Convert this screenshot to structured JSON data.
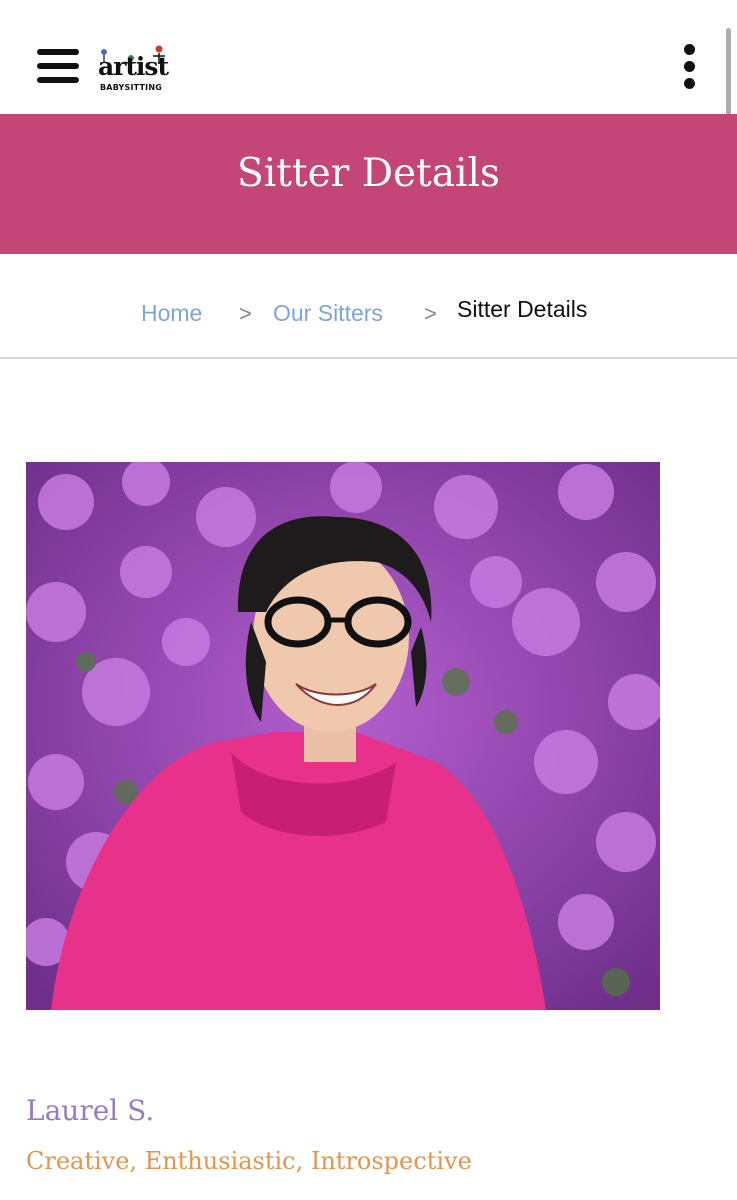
{
  "header": {
    "logo_word": "artist",
    "logo_sub": "BABYSITTING",
    "menu_icon": "hamburger-icon",
    "more_icon": "kebab-menu-icon"
  },
  "banner": {
    "title": "Sitter Details",
    "color": "#c44676"
  },
  "breadcrumb": {
    "items": [
      "Home",
      "Our Sitters",
      "Sitter Details"
    ],
    "separator": ">"
  },
  "profile": {
    "photo_alt": "Laurel S.",
    "name": "Laurel S.",
    "traits": "Creative, Enthusiastic, Introspective"
  },
  "colors": {
    "link": "#7fa4dc",
    "name": "#9a7bc2",
    "traits": "#e3944f"
  }
}
